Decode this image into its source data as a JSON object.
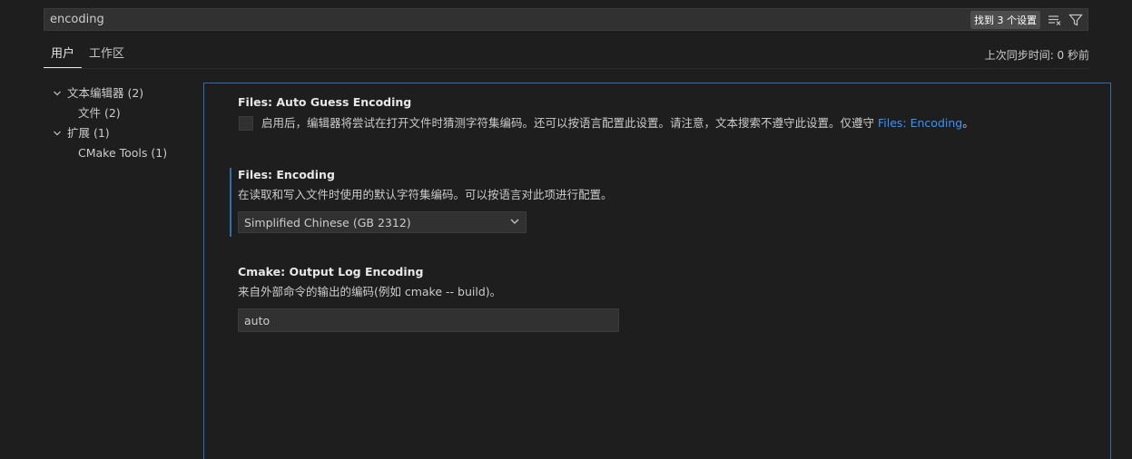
{
  "search": {
    "value": "encoding",
    "result_badge": "找到 3 个设置"
  },
  "tabs": [
    {
      "label": "用户",
      "active": true
    },
    {
      "label": "工作区",
      "active": false
    }
  ],
  "sync_label": "上次同步时间: 0 秒前",
  "toc": {
    "items": [
      {
        "label": "文本编辑器 (2)",
        "expanded": true
      },
      {
        "label": "文件 (2)"
      },
      {
        "label": "扩展 (1)",
        "expanded": true
      },
      {
        "label": "CMake Tools (1)"
      }
    ]
  },
  "settings": {
    "auto_guess": {
      "title": "Files: Auto Guess Encoding",
      "desc": "启用后，编辑器将尝试在打开文件时猜测字符集编码。还可以按语言配置此设置。请注意，文本搜索不遵守此设置。仅遵守",
      "link": "Files: Encoding",
      "desc_end": "。",
      "checked": false
    },
    "encoding": {
      "title": "Files: Encoding",
      "desc": "在读取和写入文件时使用的默认字符集编码。可以按语言对此项进行配置。",
      "value": "Simplified Chinese (GB 2312)"
    },
    "cmake_log": {
      "title": "Cmake: Output Log Encoding",
      "desc": "来自外部命令的输出的编码(例如 cmake -- build)。",
      "value": "auto"
    }
  },
  "colors": {
    "accent": "#2f6fb0",
    "link": "#3794ff",
    "background": "#1e1e1e"
  },
  "icons": {
    "clear_filter": "clear-filter-icon",
    "filter": "filter-icon",
    "chevron": "chevron-down-icon"
  }
}
